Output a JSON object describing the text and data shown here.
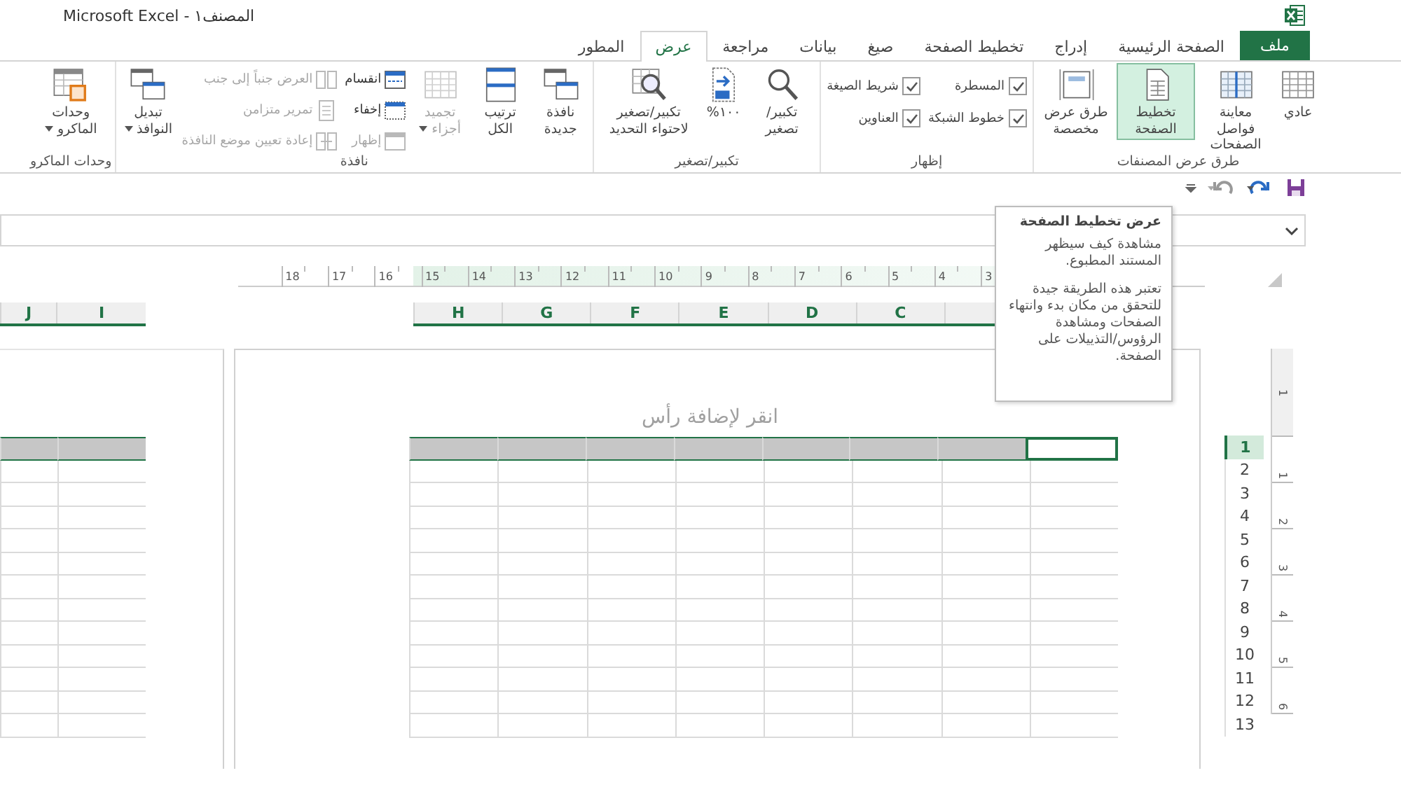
{
  "window": {
    "title": "المصنف١ - Microsoft Excel"
  },
  "tabs": [
    {
      "label": "ملف",
      "kind": "file",
      "selected": false
    },
    {
      "label": "الصفحة الرئيسية",
      "kind": "tab",
      "selected": false
    },
    {
      "label": "إدراج",
      "kind": "tab",
      "selected": false
    },
    {
      "label": "تخطيط الصفحة",
      "kind": "tab",
      "selected": false
    },
    {
      "label": "صيغ",
      "kind": "tab",
      "selected": false
    },
    {
      "label": "بيانات",
      "kind": "tab",
      "selected": false
    },
    {
      "label": "مراجعة",
      "kind": "tab",
      "selected": false
    },
    {
      "label": "عرض",
      "kind": "tab",
      "selected": true
    },
    {
      "label": "المطور",
      "kind": "tab",
      "selected": false
    }
  ],
  "ribbon": [
    {
      "label": "طرق عرض المصنفات",
      "items": [
        {
          "kind": "large",
          "label": "عادي",
          "selected": false,
          "dropdown": false,
          "disabled": false
        },
        {
          "kind": "large",
          "label": "معاينة فواصل الصفحات",
          "selected": false,
          "dropdown": false,
          "disabled": false
        },
        {
          "kind": "large",
          "label": "تخطيط الصفحة",
          "selected": true,
          "dropdown": false,
          "disabled": false
        },
        {
          "kind": "large",
          "label": "طرق عرض مخصصة",
          "selected": false,
          "dropdown": false,
          "disabled": false
        }
      ]
    },
    {
      "label": "إظهار",
      "items": [
        {
          "kind": "checks",
          "items": [
            {
              "label": "المسطرة",
              "checked": true
            },
            {
              "label": "خطوط الشبكة",
              "checked": true
            }
          ]
        },
        {
          "kind": "checks",
          "items": [
            {
              "label": "شريط الصيغة",
              "checked": true
            },
            {
              "label": "العناوين",
              "checked": true
            }
          ]
        }
      ]
    },
    {
      "label": "تكبير/تصغير",
      "items": [
        {
          "kind": "large",
          "label": "تكبير/ تصغير",
          "dropdown": false,
          "disabled": false
        },
        {
          "kind": "large",
          "label": "١٠٠%",
          "dropdown": false,
          "disabled": false
        },
        {
          "kind": "large",
          "label": "تكبير/تصغير لاحتواء التحديد",
          "dropdown": false,
          "disabled": false
        }
      ]
    },
    {
      "label": "نافذة",
      "items": [
        {
          "kind": "large",
          "label": "نافذة جديدة",
          "dropdown": false,
          "disabled": false
        },
        {
          "kind": "large",
          "label": "ترتيب الكل",
          "dropdown": false,
          "disabled": false
        },
        {
          "kind": "large",
          "label": "تجميد أجزاء",
          "dropdown": true,
          "disabled": true
        },
        {
          "kind": "stack",
          "items": [
            {
              "label": "انقسام",
              "disabled": false
            },
            {
              "label": "إخفاء",
              "disabled": false
            },
            {
              "label": "إظهار",
              "disabled": true
            }
          ]
        },
        {
          "kind": "stack",
          "items": [
            {
              "label": "العرض جنباً إلى جنب",
              "disabled": true
            },
            {
              "label": "تمرير متزامن",
              "disabled": true
            },
            {
              "label": "إعادة تعيين موضع النافذة",
              "disabled": true
            }
          ]
        },
        {
          "kind": "large",
          "label": "تبديل النوافذ",
          "dropdown": true,
          "disabled": false
        }
      ]
    },
    {
      "label": "وحدات الماكرو",
      "items": [
        {
          "kind": "large",
          "label": "وحدات الماكرو",
          "dropdown": true,
          "disabled": false
        }
      ]
    }
  ],
  "ruler": {
    "marks": [
      "3",
      "4",
      "5",
      "6",
      "7",
      "8",
      "9",
      "10",
      "11",
      "12",
      "13",
      "14",
      "15",
      "16",
      "17",
      "18"
    ]
  },
  "vertical_ruler": {
    "marks": [
      "1",
      "1",
      "2",
      "3",
      "4",
      "5",
      "6"
    ]
  },
  "pages": [
    {
      "header_placeholder": "انقر لإضافة رأس",
      "columns": [
        "C",
        "D",
        "E",
        "F",
        "G",
        "H"
      ]
    },
    {
      "columns": [
        "I",
        "J"
      ]
    }
  ],
  "rows": [
    {
      "label": "1",
      "selected": true
    },
    {
      "label": "2",
      "selected": false
    },
    {
      "label": "3",
      "selected": false
    },
    {
      "label": "4",
      "selected": false
    },
    {
      "label": "5",
      "selected": false
    },
    {
      "label": "6",
      "selected": false
    },
    {
      "label": "7",
      "selected": false
    },
    {
      "label": "8",
      "selected": false
    },
    {
      "label": "9",
      "selected": false
    },
    {
      "label": "10",
      "selected": false
    },
    {
      "label": "11",
      "selected": false
    },
    {
      "label": "12",
      "selected": false
    },
    {
      "label": "13",
      "selected": false
    }
  ],
  "tooltip": {
    "title": "عرض تخطيط الصفحة",
    "paragraphs": [
      "مشاهدة كيف سيظهر المستند المطبوع.",
      "تعتبر هذه الطريقة جيدة للتحقق من مكان بدء وانتهاء الصفحات ومشاهدة الرؤوس/التذييلات على الصفحة."
    ]
  }
}
